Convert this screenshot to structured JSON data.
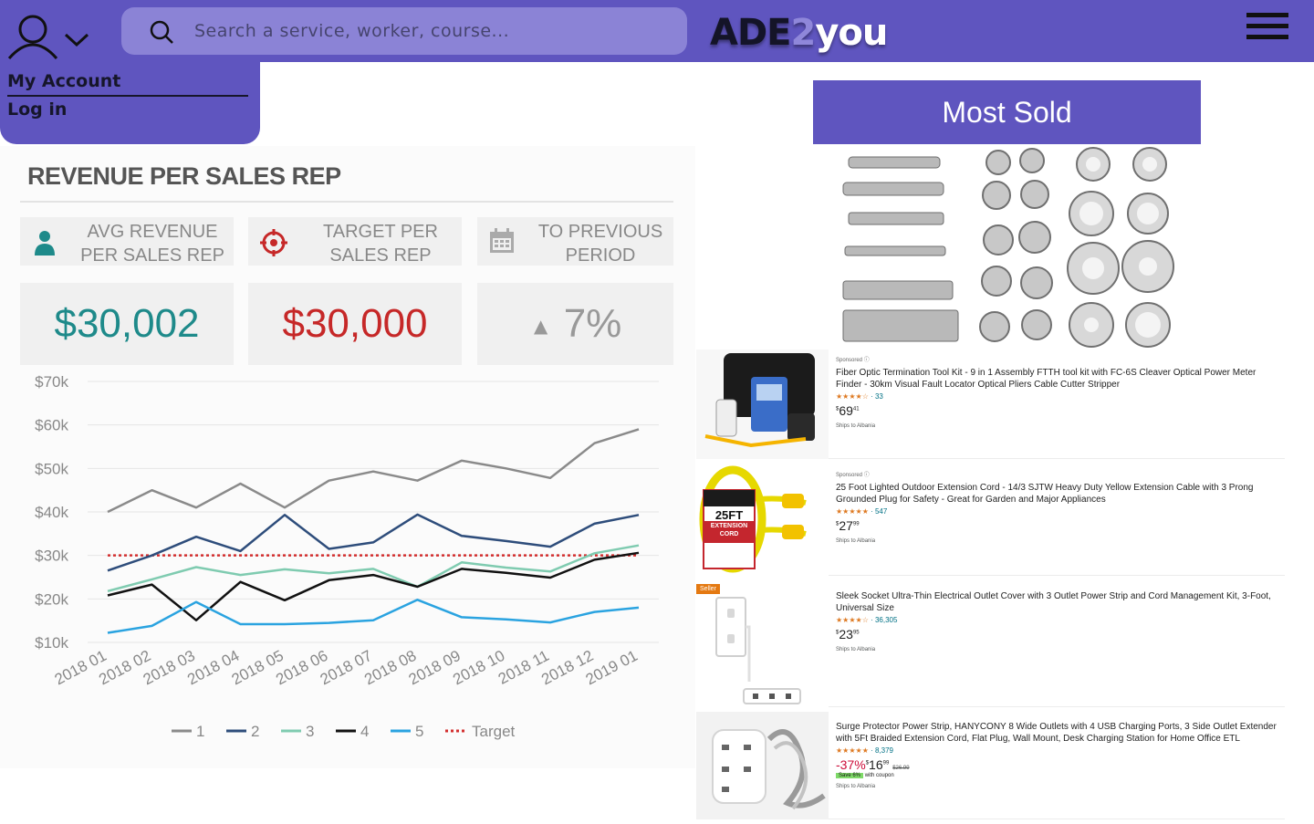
{
  "header": {
    "search_placeholder": "Search a service, worker, course...",
    "logo_part1": "ADE",
    "logo_part2": "2",
    "logo_part3": "you"
  },
  "account_menu": {
    "my_account": "My Account",
    "log_in": "Log in"
  },
  "dashboard": {
    "title": "REVENUE PER SALES REP",
    "kpis": [
      {
        "label_line1": "AVG REVENUE",
        "label_line2": "PER SALES REP",
        "value": "$30,002",
        "color": "#1e8a8a"
      },
      {
        "label_line1": "TARGET PER",
        "label_line2": "SALES REP",
        "value": "$30,000",
        "color": "#c62828"
      },
      {
        "label_line1": "TO PREVIOUS",
        "label_line2": "PERIOD",
        "value": "7%",
        "color": "#999999"
      }
    ]
  },
  "chart_data": {
    "type": "line",
    "title": "",
    "xlabel": "",
    "ylabel": "",
    "ylim": [
      10000,
      70000
    ],
    "yticks": [
      "$70k",
      "$60k",
      "$50k",
      "$40k",
      "$30k",
      "$20k",
      "$10k"
    ],
    "categories": [
      "2018 01",
      "2018 02",
      "2018 03",
      "2018 04",
      "2018 05",
      "2018 06",
      "2018 07",
      "2018 08",
      "2018 09",
      "2018 10",
      "2018 11",
      "2018 12",
      "2019 01"
    ],
    "series": [
      {
        "name": "1",
        "color": "#8a8a8a",
        "values": [
          40000,
          45000,
          41000,
          46500,
          41000,
          47200,
          49300,
          47200,
          51800,
          50000,
          47800,
          55800,
          59000
        ]
      },
      {
        "name": "2",
        "color": "#2e4d7b",
        "values": [
          26500,
          30000,
          34300,
          31000,
          39300,
          31500,
          33000,
          39400,
          34500,
          33300,
          32000,
          37300,
          39300
        ]
      },
      {
        "name": "3",
        "color": "#7fcbb0",
        "values": [
          21800,
          24500,
          27300,
          25500,
          26800,
          25900,
          26900,
          22800,
          28400,
          27200,
          26300,
          30500,
          32300
        ]
      },
      {
        "name": "4",
        "color": "#111111",
        "values": [
          20800,
          23300,
          15100,
          23900,
          19700,
          24300,
          25500,
          22800,
          26900,
          26000,
          24900,
          29000,
          30600
        ]
      },
      {
        "name": "5",
        "color": "#2aa3e0",
        "values": [
          12200,
          13800,
          19300,
          14200,
          14200,
          14500,
          15100,
          19800,
          15800,
          15300,
          14600,
          17000,
          18000
        ]
      }
    ],
    "target": {
      "name": "Target",
      "value": 30000,
      "color": "#d32f2f"
    },
    "grid": true,
    "legend": "bottom"
  },
  "most_sold_label": "Most Sold",
  "products": [
    {
      "sponsored": "Sponsored",
      "title": "Fiber Optic Termination Tool Kit - 9 in 1 Assembly FTTH tool kit with FC-6S Cleaver Optical Power Meter Finder - 30km Visual Fault Locator Optical Pliers Cable Cutter Stripper",
      "stars": "★★★★☆",
      "rating_count": "33",
      "price_whole": "69",
      "price_cents": "41",
      "ships": "Ships to Albania"
    },
    {
      "sponsored": "Sponsored",
      "title": "25 Foot Lighted Outdoor Extension Cord - 14/3 SJTW Heavy Duty Yellow Extension Cable with 3 Prong Grounded Plug for Safety - Great for Garden and Major Appliances",
      "stars": "★★★★★",
      "rating_count": "547",
      "price_whole": "27",
      "price_cents": "99",
      "ships": "Ships to Albania",
      "thumb_text_1": "25FT",
      "thumb_text_2": "EXTENSION",
      "thumb_text_3": "CORD"
    },
    {
      "badge": "Seller",
      "title": "Sleek Socket Ultra-Thin Electrical Outlet Cover with 3 Outlet Power Strip and Cord Management Kit, 3-Foot, Universal Size",
      "stars": "★★★★☆",
      "rating_count": "36,305",
      "price_whole": "23",
      "price_cents": "95",
      "ships": "Ships to Albania"
    },
    {
      "title": "Surge Protector Power Strip, HANYCONY 8 Wide Outlets with 4 USB Charging Ports, 3 Side Outlet Extender with 5Ft Braided Extension Cord, Flat Plug, Wall Mount, Desk Charging Station for Home Office ETL",
      "stars": "★★★★★",
      "rating_count": "8,379",
      "discount": "-37%",
      "price_whole": "16",
      "price_cents": "99",
      "list_price": "$26.99",
      "save_badge": "Save 6%",
      "coupon_text": "with coupon",
      "ships": "Ships to Albania"
    }
  ]
}
